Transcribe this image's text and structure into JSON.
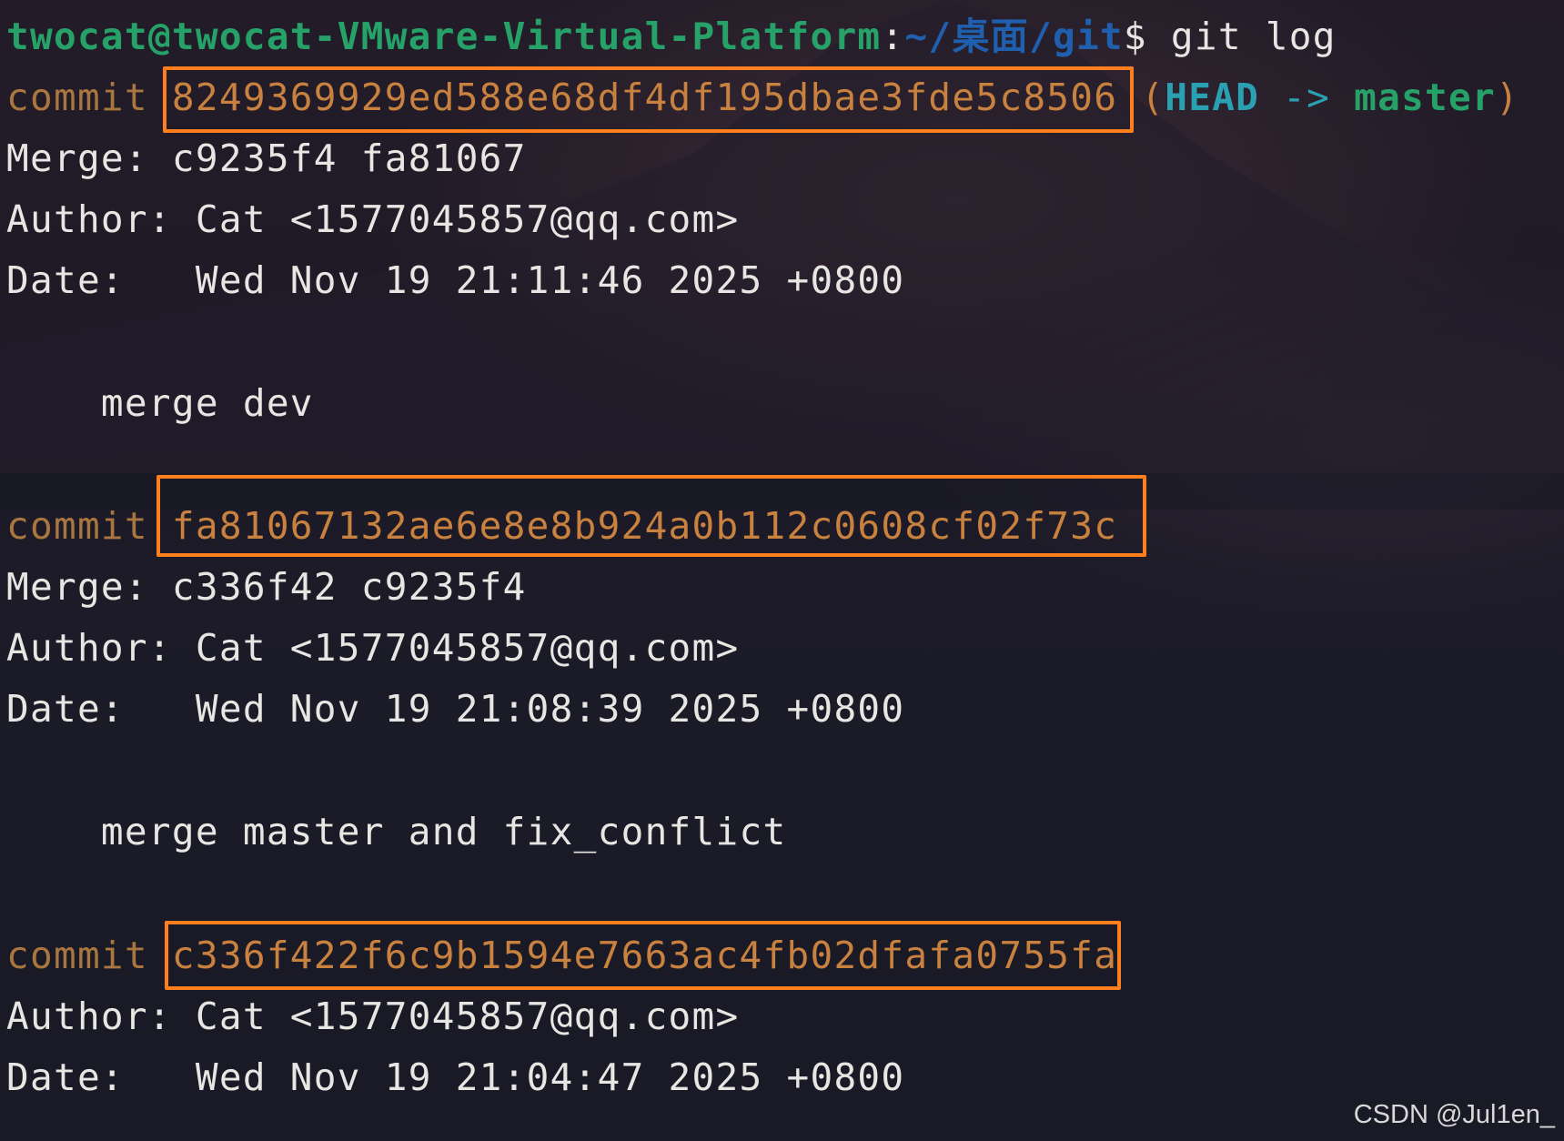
{
  "prompt": {
    "user_host": "twocat@twocat-VMware-Virtual-Platform",
    "colon": ":",
    "path": "~/桌面/git",
    "dollar": "$",
    "command": " git log"
  },
  "commits": [
    {
      "keyword": "commit",
      "hash": "8249369929ed588e68df4df195dbae3fde5c8506",
      "refs": {
        "open": "(",
        "head": "HEAD",
        "arrow": "->",
        "branch": "master",
        "close": ")"
      },
      "merge_line": "Merge: c9235f4 fa81067",
      "author_line": "Author: Cat <1577045857@qq.com>",
      "date_line": "Date:   Wed Nov 19 21:11:46 2025 +0800",
      "message": "    merge dev"
    },
    {
      "keyword": "commit",
      "hash": "fa81067132ae6e8e8b924a0b112c0608cf02f73c",
      "merge_line": "Merge: c336f42 c9235f4",
      "author_line": "Author: Cat <1577045857@qq.com>",
      "date_line": "Date:   Wed Nov 19 21:08:39 2025 +0800",
      "message": "    merge master and fix_conflict"
    },
    {
      "keyword": "commit",
      "hash": "c336f422f6c9b1594e7663ac4fb02dfafa0755fa",
      "author_line": "Author: Cat <1577045857@qq.com>",
      "date_line": "Date:   Wed Nov 19 21:04:47 2025 +0800"
    }
  ],
  "colors": {
    "highlight_box": "#ff7f1e",
    "prompt_user": "#26a269",
    "prompt_path": "#1f5fae",
    "hash": "#c8813f",
    "head_ref": "#2aa1b3"
  },
  "watermark": "CSDN @Jul1en_"
}
